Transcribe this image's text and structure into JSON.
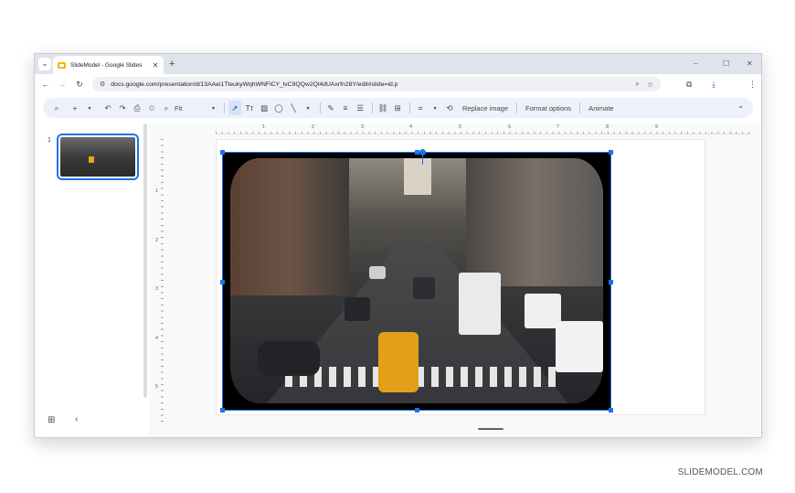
{
  "browser": {
    "tab_search_icon": "chevron-down-icon",
    "tab_title": "SlideModel - Google Slides",
    "tab_close": "✕",
    "new_tab": "+",
    "window_controls": {
      "minimize": "–",
      "maximize": "☐",
      "close": "✕"
    },
    "url": "docs.google.com/presentation/d/13AAei1TteukyWqhWNFiCY_lvC9QQw2Ql4dUAxrfn28Y/edit#slide=id.p"
  },
  "toolbar": {
    "zoom_value": "Fit",
    "replace_image": "Replace image",
    "format_options": "Format options",
    "animate": "Animate"
  },
  "filmstrip": {
    "slides": [
      {
        "number": "1"
      }
    ]
  },
  "ruler": {
    "h_labels": [
      "1",
      "2",
      "3",
      "4",
      "5",
      "6",
      "7",
      "8",
      "9"
    ],
    "v_labels": [
      "1",
      "2",
      "3",
      "4",
      "5"
    ]
  },
  "colors": {
    "accent": "#1a73e8",
    "toolbar_bg": "#edf2fa",
    "tab_strip_bg": "#dfe3eb",
    "slides_icon": "#f4b400"
  },
  "watermark": "SLIDEMODEL.COM"
}
